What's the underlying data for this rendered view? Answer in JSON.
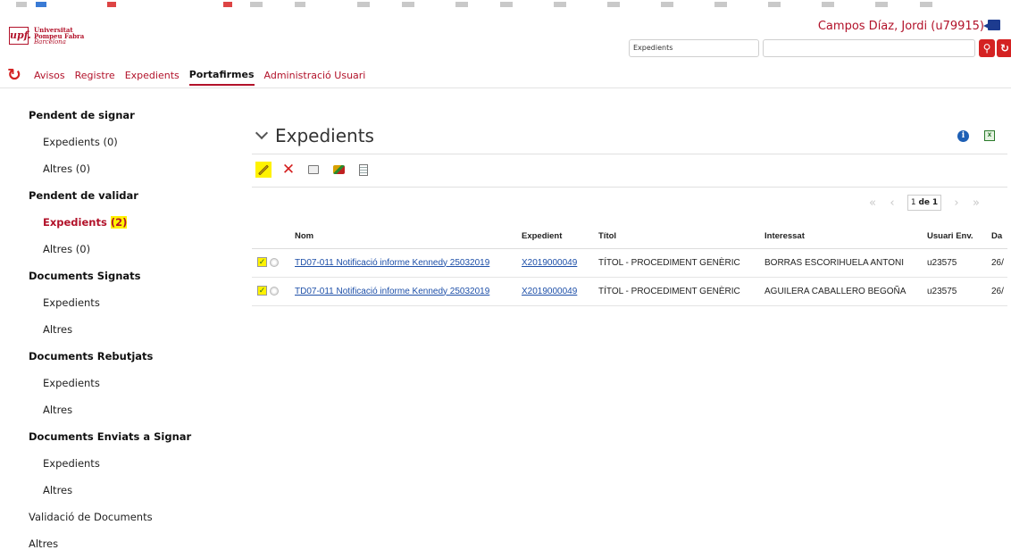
{
  "brand": {
    "logo_mark": "upf.",
    "line1": "Universitat",
    "line2": "Pompeu Fabra",
    "line3": "Barcelona"
  },
  "user": {
    "name": "Campos Díaz, Jordi (u79915)"
  },
  "search": {
    "scope_value": "Expedients",
    "query_value": ""
  },
  "nav": {
    "items": [
      {
        "label": "Avisos",
        "active": false
      },
      {
        "label": "Registre",
        "active": false
      },
      {
        "label": "Expedients",
        "active": false
      },
      {
        "label": "Portafirmes",
        "active": true
      },
      {
        "label": "Administració Usuari",
        "active": false
      }
    ]
  },
  "sidebar": {
    "pending_sign": {
      "title": "Pendent de signar",
      "items": [
        "Expedients (0)",
        "Altres (0)"
      ]
    },
    "pending_validate": {
      "title": "Pendent de validar",
      "active_label": "Expedients",
      "active_count": "(2)",
      "items": [
        "Altres (0)"
      ]
    },
    "signed": {
      "title": "Documents Signats",
      "items": [
        "Expedients",
        "Altres"
      ]
    },
    "rejected": {
      "title": "Documents Rebutjats",
      "items": [
        "Expedients",
        "Altres"
      ]
    },
    "sent": {
      "title": "Documents Enviats a Signar",
      "items": [
        "Expedients",
        "Altres"
      ]
    },
    "validation": "Validació de Documents",
    "others": "Altres"
  },
  "main": {
    "title": "Expedients",
    "pager": {
      "current": "1",
      "of_label": "de",
      "total": "1"
    },
    "table": {
      "columns": [
        "Nom",
        "Expedient",
        "Títol",
        "Interessat",
        "Usuari Env.",
        "Da"
      ],
      "rows": [
        {
          "checked": true,
          "name": "TD07-011 Notificació informe Kennedy 25032019",
          "expedient": "X2019000049",
          "title": "TÍTOL - PROCEDIMENT GENÈRIC",
          "interessat": "BORRAS ESCORIHUELA ANTONI",
          "user": "u23575",
          "date": "26/"
        },
        {
          "checked": true,
          "name": "TD07-011 Notificació informe Kennedy 25032019",
          "expedient": "X2019000049",
          "title": "TÍTOL - PROCEDIMENT GENÈRIC",
          "interessat": "AGUILERA CABALLERO BEGOÑA",
          "user": "u23575",
          "date": "26/"
        }
      ]
    }
  },
  "icons": {
    "reload": "reload-icon",
    "search": "search-icon",
    "clear": "clear-search-icon",
    "exit": "logout-icon",
    "sign": "pencil-icon",
    "reject": "reject-icon",
    "print": "print-icon",
    "send_sign": "send-to-sign-icon",
    "doc": "document-list-icon",
    "info": "info-icon",
    "excel": "excel-export-icon"
  },
  "colors": {
    "accent": "#b2122a",
    "highlight": "#fff200",
    "link": "#1d4fa8"
  }
}
